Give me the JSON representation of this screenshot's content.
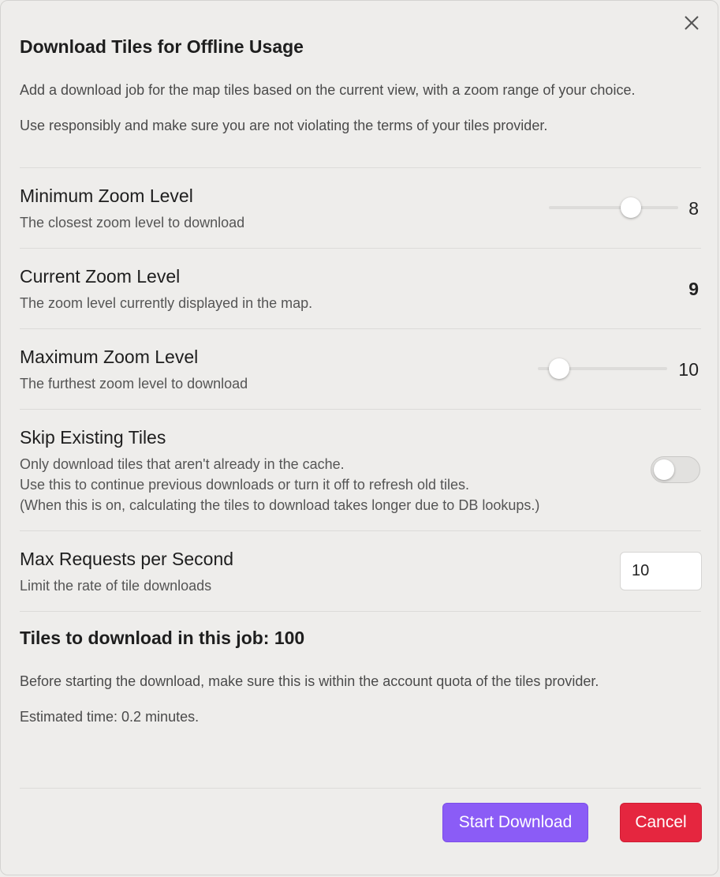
{
  "dialog": {
    "title": "Download Tiles for Offline Usage",
    "description_1": "Add a download job for the map tiles based on the current view, with a zoom range of your choice.",
    "description_2": "Use responsibly and make sure you are not violating the terms of your tiles provider."
  },
  "settings": {
    "min_zoom": {
      "name": "Minimum Zoom Level",
      "desc": "The closest zoom level to download",
      "value": "8"
    },
    "current_zoom": {
      "name": "Current Zoom Level",
      "desc": "The zoom level currently displayed in the map.",
      "value": "9"
    },
    "max_zoom": {
      "name": "Maximum Zoom Level",
      "desc": "The furthest zoom level to download",
      "value": "10"
    },
    "skip_existing": {
      "name": "Skip Existing Tiles",
      "desc_1": "Only download tiles that aren't already in the cache.",
      "desc_2": "Use this to continue previous downloads or turn it off to refresh old tiles.",
      "desc_3": "(When this is on, calculating the tiles to download takes longer due to DB lookups.)",
      "enabled": false
    },
    "max_requests": {
      "name": "Max Requests per Second",
      "desc": "Limit the rate of tile downloads",
      "value": "10"
    }
  },
  "summary": {
    "tiles_heading": "Tiles to download in this job: 100",
    "quota_note": "Before starting the download, make sure this is within the account quota of the tiles provider.",
    "estimated_time": "Estimated time: 0.2 minutes."
  },
  "buttons": {
    "start": "Start Download",
    "cancel": "Cancel"
  },
  "icons": {
    "close": "close-icon"
  },
  "colors": {
    "primary": "#8b5cf6",
    "danger": "#e5263f",
    "background": "#eeedeb"
  }
}
